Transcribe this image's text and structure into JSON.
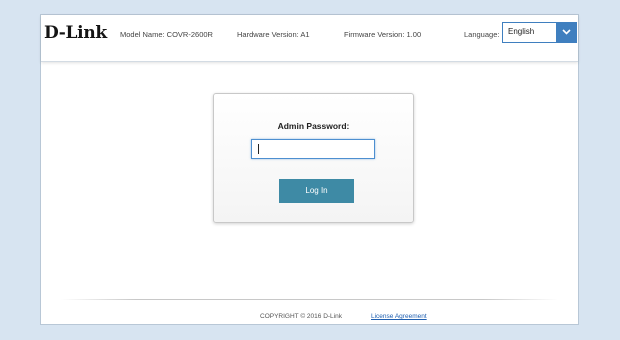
{
  "header": {
    "logo": "D-Link",
    "model": "Model Name: COVR-2600R",
    "hardware": "Hardware Version: A1",
    "firmware": "Firmware Version: 1.00",
    "language_label": "Language:",
    "language_value": "English"
  },
  "login": {
    "password_label": "Admin Password:",
    "password_value": "",
    "button_label": "Log In"
  },
  "footer": {
    "copyright": "COPYRIGHT © 2016 D-Link",
    "license_link": "License Agreement"
  },
  "colors": {
    "page_background": "#d7e4f1",
    "select_accent": "#3f7fbf",
    "button": "#3e8aa5",
    "link": "#1f5fb0"
  },
  "icons": {
    "dropdown": "chevron-down-icon"
  }
}
